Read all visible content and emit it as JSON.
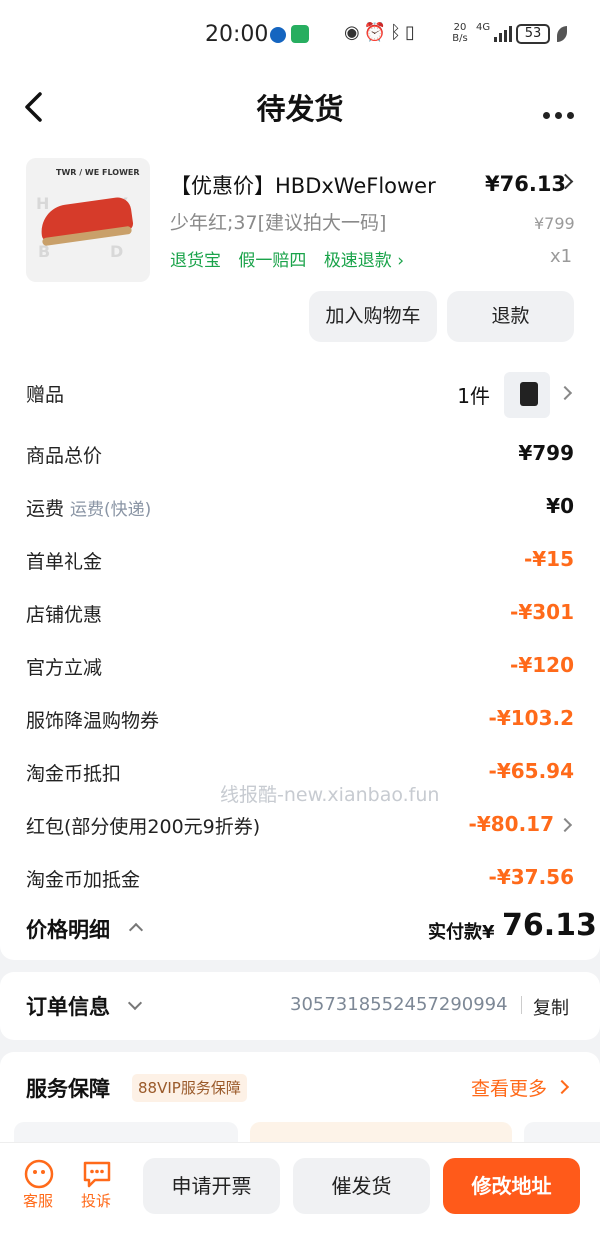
{
  "status_bar": {
    "time": "20:00",
    "net_speed": "20 B/s",
    "network": "4G",
    "battery": "53"
  },
  "nav": {
    "title": "待发货"
  },
  "product": {
    "image_label": "TWR / WE FLOWER",
    "title": "【优惠价】HBDxWeFlower",
    "price": "¥76.13",
    "spec": "少年红;37[建议拍大一码]",
    "original_price": "¥799",
    "tags": [
      "退货宝",
      "假一赔四",
      "极速退款 ›"
    ],
    "quantity": "x1",
    "buttons": {
      "add_cart": "加入购物车",
      "refund": "退款"
    }
  },
  "price_rows": [
    {
      "label": "赠品",
      "value": "1件"
    },
    {
      "label": "商品总价",
      "value": "¥799"
    },
    {
      "label": "运费",
      "sub": "运费(快递)",
      "value": "¥0"
    },
    {
      "label": "首单礼金",
      "value": "-¥15"
    },
    {
      "label": "店铺优惠",
      "value": "-¥301"
    },
    {
      "label": "官方立减",
      "value": "-¥120"
    },
    {
      "label": "服饰降温购物券",
      "value": "-¥103.2"
    },
    {
      "label": "淘金币抵扣",
      "value": "-¥65.94"
    },
    {
      "label": "红包(部分使用200元9折券)",
      "value": "-¥80.17"
    },
    {
      "label": "淘金币加抵金",
      "value": "-¥37.56"
    }
  ],
  "watermark": "线报酷-new.xianbao.fun",
  "summary": {
    "label": "价格明细",
    "paid_label": "实付款¥",
    "paid_amount": "76.13"
  },
  "order": {
    "label": "订单信息",
    "number": "3057318552457290994",
    "copy": "复制"
  },
  "service": {
    "label": "服务保障",
    "badge": "88VIP服务保障",
    "more": "查看更多"
  },
  "bottom": {
    "service_label": "客服",
    "complain_label": "投诉",
    "invoice": "申请开票",
    "urge": "催发货",
    "modify_address": "修改地址"
  },
  "colors": {
    "accent": "#ff6a1a",
    "primary_button": "#ff5a1a",
    "tag_green": "#1aa34a"
  }
}
